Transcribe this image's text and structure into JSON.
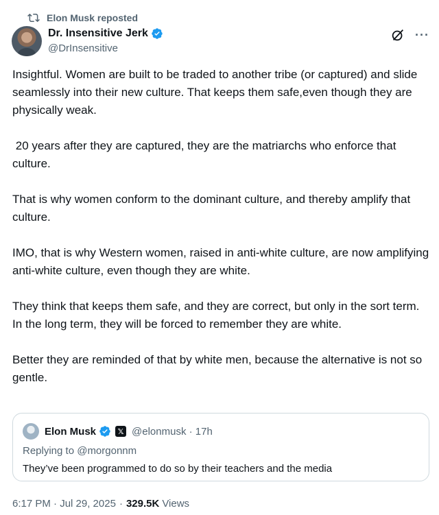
{
  "repost": {
    "label": "Elon Musk reposted",
    "icon": "repost-icon"
  },
  "author": {
    "name": "Dr. Insensitive Jerk",
    "handle": "@DrInsensitive",
    "verified_color": "#1d9bf0"
  },
  "actions": {
    "grok_icon": "grok-icon",
    "more": "···"
  },
  "tweet": {
    "paragraphs": [
      "Insightful. Women are built to be traded to another tribe (or captured) and slide seamlessly into their new culture. That keeps them safe,even though they are physically weak.",
      " 20 years after they are captured, they are the matriarchs who enforce that culture.",
      "That is why women conform to the dominant culture, and thereby amplify that culture.",
      "IMO, that is why Western women, raised in anti-white culture, are now amplifying anti-white culture, even though they are white.",
      "They think that keeps them safe, and they are correct, but only in the sort term. In the long term, they will be forced to remember they are white.",
      "Better they are reminded of that by white men, because the alternative is not so gentle."
    ]
  },
  "quote": {
    "name": "Elon Musk",
    "handle_time": "@elonmusk · 17h",
    "replying_to": "Replying to @morgonnm",
    "text": "They’ve been programmed to do so by their teachers and the media"
  },
  "meta": {
    "timestamp": "6:17 PM · Jul 29, 2025",
    "sep": "·",
    "views_count": "329.5K",
    "views_label": "Views"
  }
}
